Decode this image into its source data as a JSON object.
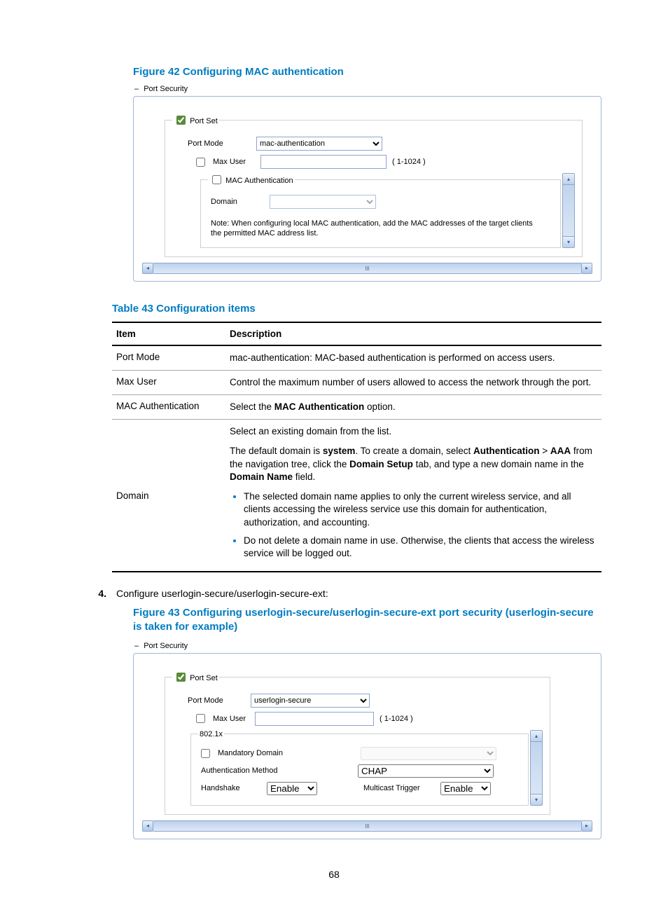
{
  "fig42": {
    "caption": "Figure 42 Configuring MAC authentication",
    "tree_label": "Port Security",
    "portset": {
      "legend_text": "Port Set",
      "port_mode_label": "Port Mode",
      "port_mode_value": "mac-authentication",
      "max_user_label": "Max User",
      "max_user_value": "",
      "max_user_hint": "( 1-1024 )"
    },
    "macauth": {
      "legend_text": "MAC Authentication",
      "domain_label": "Domain",
      "domain_value": "",
      "note": "Note: When configuring local MAC authentication, add the MAC addresses of the target clients the permitted MAC address list."
    }
  },
  "table43": {
    "caption": "Table 43 Configuration items",
    "head_item": "Item",
    "head_desc": "Description",
    "rows": {
      "port_mode": {
        "item": "Port Mode",
        "desc": "mac-authentication: MAC-based authentication is performed on access users."
      },
      "max_user": {
        "item": "Max User",
        "desc": "Control the maximum number of users allowed to access the network through the port."
      },
      "mac_auth": {
        "item": "MAC Authentication",
        "desc_pre": "Select the ",
        "desc_bold": "MAC Authentication",
        "desc_post": " option."
      },
      "domain": {
        "item": "Domain",
        "p1": "Select an existing domain from the list.",
        "p2a": "The default domain is ",
        "p2b": "system",
        "p2c": ". To create a domain, select ",
        "p2d": "Authentication",
        "p2e": " > ",
        "p2f": "AAA",
        "p2g": " from the navigation tree, click the ",
        "p2h": "Domain Setup",
        "p2i": " tab, and type a new domain name in the ",
        "p2j": "Domain Name",
        "p2k": " field.",
        "li1": "The selected domain name applies to only the current wireless service, and all clients accessing the wireless service use this domain for authentication, authorization, and accounting.",
        "li2": "Do not delete a domain name in use. Otherwise, the clients that access the wireless service will be logged out."
      }
    }
  },
  "step4": {
    "num": "4.",
    "text": "Configure userlogin-secure/userlogin-secure-ext:"
  },
  "fig43": {
    "caption": "Figure 43 Configuring userlogin-secure/userlogin-secure-ext port security (userlogin-secure is taken for example)",
    "tree_label": "Port Security",
    "portset": {
      "legend_text": "Port Set",
      "port_mode_label": "Port Mode",
      "port_mode_value": "userlogin-secure",
      "max_user_label": "Max User",
      "max_user_value": "",
      "max_user_hint": "( 1-1024 )"
    },
    "dot1x": {
      "legend_text": "802.1x",
      "mand_domain_label": "Mandatory Domain",
      "mand_domain_value": "",
      "auth_method_label": "Authentication Method",
      "auth_method_value": "CHAP",
      "handshake_label": "Handshake",
      "handshake_value": "Enable",
      "mtrigger_label": "Multicast Trigger",
      "mtrigger_value": "Enable"
    }
  },
  "page_number": "68"
}
